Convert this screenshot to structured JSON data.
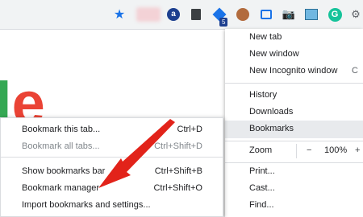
{
  "toolbar": {
    "icons": [
      "star-icon",
      "blurred-extension",
      "extension-a-icon",
      "bookmark-extension-icon",
      "diamond-extension-icon",
      "avatar-extension-icon",
      "card-extension-icon",
      "camera-icon",
      "image-extension-icon",
      "grammarly-icon",
      "puzzle-icon"
    ],
    "star_glyph": "★",
    "ext_a_letter": "a",
    "badge_count": "5",
    "camera_glyph": "📷",
    "grammarly_letter": "G",
    "puzzle_glyph": "⚙"
  },
  "logo": {
    "letter_l": "l",
    "letter_e": "e"
  },
  "main_menu": {
    "new_tab": "New tab",
    "new_window": "New window",
    "new_incognito": "New Incognito window",
    "incognito_shortcut": "C",
    "history": "History",
    "downloads": "Downloads",
    "bookmarks": "Bookmarks",
    "zoom": "Zoom",
    "zoom_minus": "−",
    "zoom_value": "100%",
    "zoom_plus": "+",
    "print": "Print...",
    "cast": "Cast...",
    "find": "Find..."
  },
  "bookmarks_submenu": {
    "bookmark_this_tab": "Bookmark this tab...",
    "bookmark_this_tab_shortcut": "Ctrl+D",
    "bookmark_all_tabs": "Bookmark all tabs...",
    "bookmark_all_tabs_shortcut": "Ctrl+Shift+D",
    "show_bookmarks_bar": "Show bookmarks bar",
    "show_bookmarks_bar_shortcut": "Ctrl+Shift+B",
    "bookmark_manager": "Bookmark manager",
    "bookmark_manager_shortcut": "Ctrl+Shift+O",
    "import_bookmarks": "Import bookmarks and settings..."
  },
  "colors": {
    "accent": "#1a73e8",
    "highlight": "#e8eaed",
    "arrow": "#e2231a"
  }
}
